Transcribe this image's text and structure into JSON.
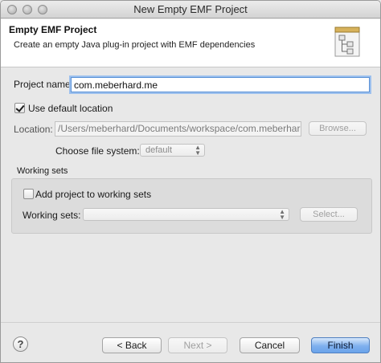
{
  "window": {
    "title": "New Empty EMF Project"
  },
  "header": {
    "title": "Empty EMF Project",
    "description": "Create an empty Java plug-in project with EMF dependencies",
    "icon": "wizard-project-icon"
  },
  "form": {
    "project_name_label": "Project name:",
    "project_name_value": "com.meberhard.me",
    "use_default_location_label": "Use default location",
    "use_default_location_checked": true,
    "location_label": "Location:",
    "location_value": "/Users/meberhard/Documents/workspace/com.meberhard.me",
    "browse_label": "Browse...",
    "file_system_label": "Choose file system:",
    "file_system_value": "default"
  },
  "working_sets": {
    "group_label": "Working sets",
    "add_label": "Add project to working sets",
    "add_checked": false,
    "sets_label": "Working sets:",
    "sets_value": "",
    "select_label": "Select..."
  },
  "footer": {
    "help_icon": "help-icon",
    "back_label": "< Back",
    "next_label": "Next >",
    "cancel_label": "Cancel",
    "finish_label": "Finish"
  }
}
